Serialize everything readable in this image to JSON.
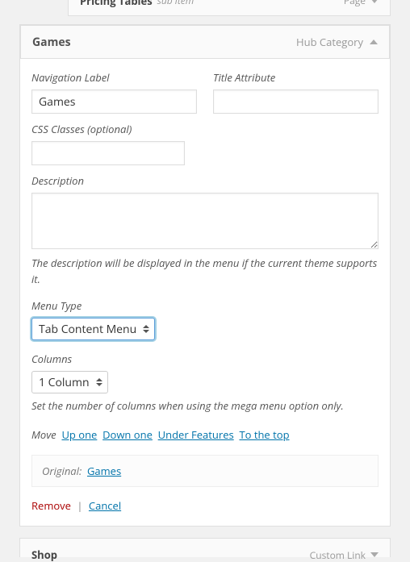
{
  "top_item": {
    "title": "Pricing Tables",
    "sub": "sub item",
    "type": "Page"
  },
  "item": {
    "title": "Games",
    "type": "Hub Category",
    "fields": {
      "nav_label": {
        "label": "Navigation Label",
        "value": "Games"
      },
      "title_attr": {
        "label": "Title Attribute",
        "value": ""
      },
      "css_classes": {
        "label": "CSS Classes (optional)",
        "value": ""
      },
      "description": {
        "label": "Description",
        "value": "",
        "helper": "The description will be displayed in the menu if the current theme supports it."
      },
      "menu_type": {
        "label": "Menu Type",
        "value": "Tab Content Menu"
      },
      "columns": {
        "label": "Columns",
        "value": "1 Column",
        "helper": "Set the number of columns when using the mega menu option only."
      }
    },
    "move": {
      "label": "Move",
      "up_one": "Up one",
      "down_one": "Down one",
      "under": "Under Features",
      "to_top": "To the top"
    },
    "original": {
      "label": "Original:",
      "link": "Games"
    },
    "actions": {
      "remove": "Remove",
      "cancel": "Cancel"
    }
  },
  "bottom_item": {
    "title": "Shop",
    "type": "Custom Link"
  }
}
